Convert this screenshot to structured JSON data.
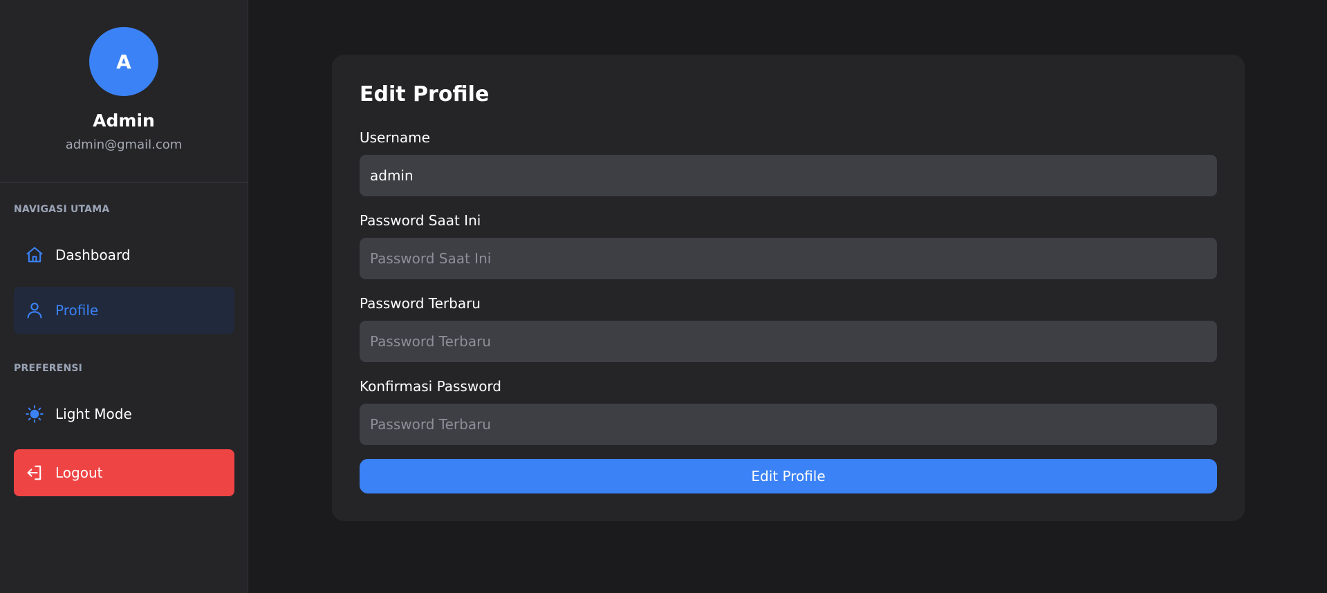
{
  "sidebar": {
    "avatar_initial": "A",
    "user_name": "Admin",
    "user_email": "admin@gmail.com",
    "sections": {
      "main_nav": "NAVIGASI UTAMA",
      "preferences": "PREFERENSI"
    },
    "items": {
      "dashboard": {
        "label": "Dashboard",
        "icon": "home-icon"
      },
      "profile": {
        "label": "Profile",
        "icon": "user-icon",
        "active": true
      },
      "light_mode": {
        "label": "Light Mode",
        "icon": "sun-icon"
      },
      "logout": {
        "label": "Logout",
        "icon": "logout-icon"
      }
    }
  },
  "form": {
    "title": "Edit Profile",
    "username": {
      "label": "Username",
      "value": "admin",
      "placeholder": ""
    },
    "current_password": {
      "label": "Password Saat Ini",
      "value": "",
      "placeholder": "Password Saat Ini"
    },
    "new_password": {
      "label": "Password Terbaru",
      "value": "",
      "placeholder": "Password Terbaru"
    },
    "confirm_password": {
      "label": "Konfirmasi Password",
      "value": "",
      "placeholder": "Password Terbaru"
    },
    "submit_label": "Edit Profile"
  },
  "colors": {
    "accent": "#3b82f6",
    "danger": "#ef4444",
    "background": "#1b1b1e",
    "panel": "#252528",
    "input": "#3e3e45"
  }
}
